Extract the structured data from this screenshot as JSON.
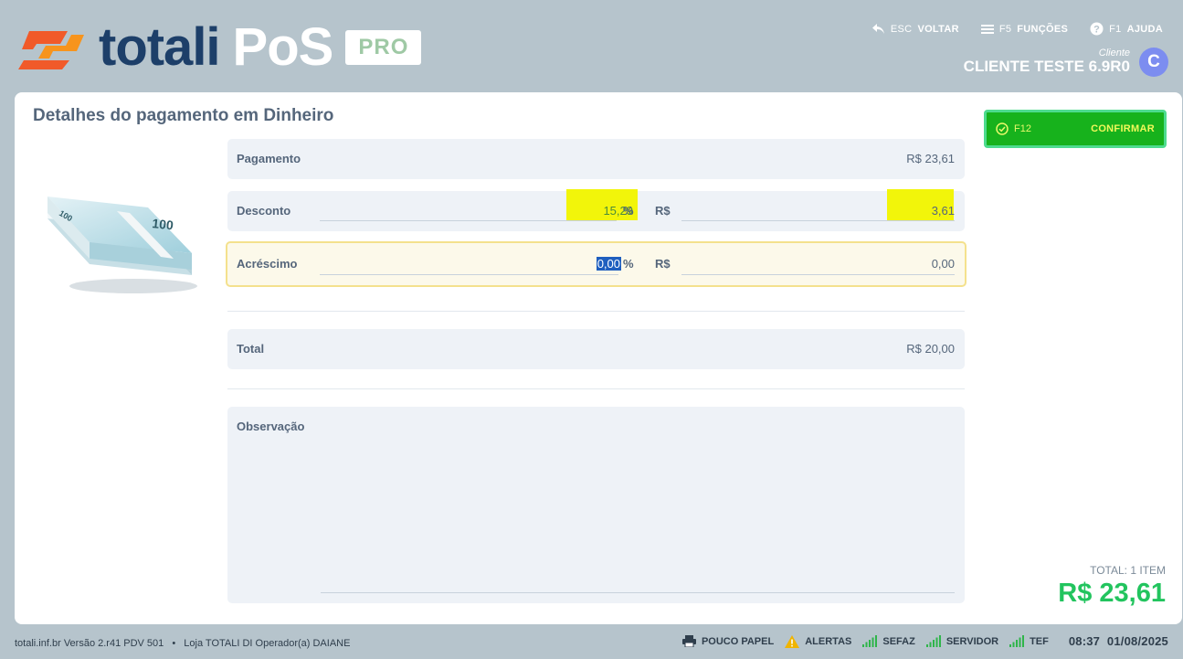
{
  "brand": {
    "name_part1": "totali",
    "name_part2": "PoS",
    "tier": "PRO"
  },
  "topnav": [
    {
      "key": "ESC",
      "label": "VOLTAR"
    },
    {
      "key": "F5",
      "label": "FUNÇÕES"
    },
    {
      "key": "F1",
      "label": "AJUDA"
    }
  ],
  "client": {
    "caption": "Cliente",
    "name": "CLIENTE TESTE 6.9R0",
    "initial": "C"
  },
  "page": {
    "title": "Detalhes do pagamento em Dinheiro"
  },
  "payment": {
    "pagamento": {
      "label": "Pagamento",
      "value": "R$ 23,61"
    },
    "desconto": {
      "label": "Desconto",
      "percent": "15,29",
      "percent_unit": "%",
      "currency_unit": "R$",
      "amount": "3,61"
    },
    "acrescimo": {
      "label": "Acréscimo",
      "percent": "0,00",
      "percent_unit": "%",
      "currency_unit": "R$",
      "amount": "0,00"
    },
    "total": {
      "label": "Total",
      "value": "R$ 20,00"
    },
    "observacao": {
      "label": "Observação",
      "value": ""
    }
  },
  "confirm": {
    "key": "F12",
    "label": "CONFIRMAR"
  },
  "summary": {
    "items": "TOTAL: 1 ITEM",
    "amount": "R$ 23,61"
  },
  "footer": {
    "site": "totali.inf.br",
    "version": "Versão 2.r41 PDV 501",
    "store": "Loja TOTALI DI Operador(a) DAIANE",
    "statuses": [
      {
        "icon": "printer-icon",
        "label": "POUCO PAPEL"
      },
      {
        "icon": "warning-icon",
        "label": "ALERTAS"
      },
      {
        "icon": "signal-icon",
        "label": "SEFAZ"
      },
      {
        "icon": "signal-icon",
        "label": "SERVIDOR"
      },
      {
        "icon": "signal-icon",
        "label": "TEF"
      }
    ],
    "time": "08:37",
    "date": "01/08/2025"
  },
  "colors": {
    "background": "#b6c4cc",
    "brand_dark": "#1d3f69",
    "brand_orange": "#f15a29",
    "confirm_green": "#17b21c",
    "total_green": "#22c45e",
    "highlight": "#f2f50a",
    "focus_border": "#f4e18d"
  }
}
